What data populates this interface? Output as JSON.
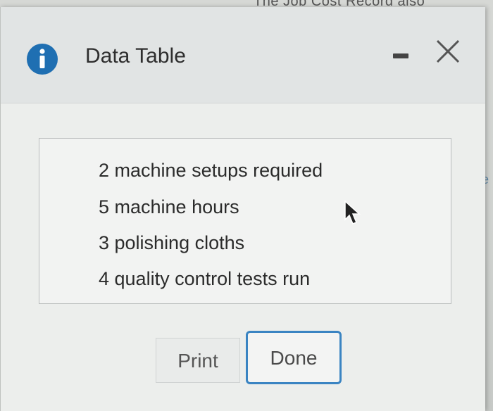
{
  "window": {
    "title": "Data Table",
    "background_title_fragment": "The Job Cost Record also",
    "background_edge_text": "e"
  },
  "titlebar": {
    "info_icon": "info-icon",
    "minimize_icon": "minimize-icon",
    "close_icon": "close-icon"
  },
  "data_table": {
    "rows": [
      "2 machine setups required",
      "5 machine hours",
      "3 polishing cloths",
      "4 quality control tests run"
    ]
  },
  "buttons": {
    "print_label": "Print",
    "done_label": "Done"
  },
  "colors": {
    "accent": "#3a84c2",
    "info_icon": "#1f6fb2"
  }
}
